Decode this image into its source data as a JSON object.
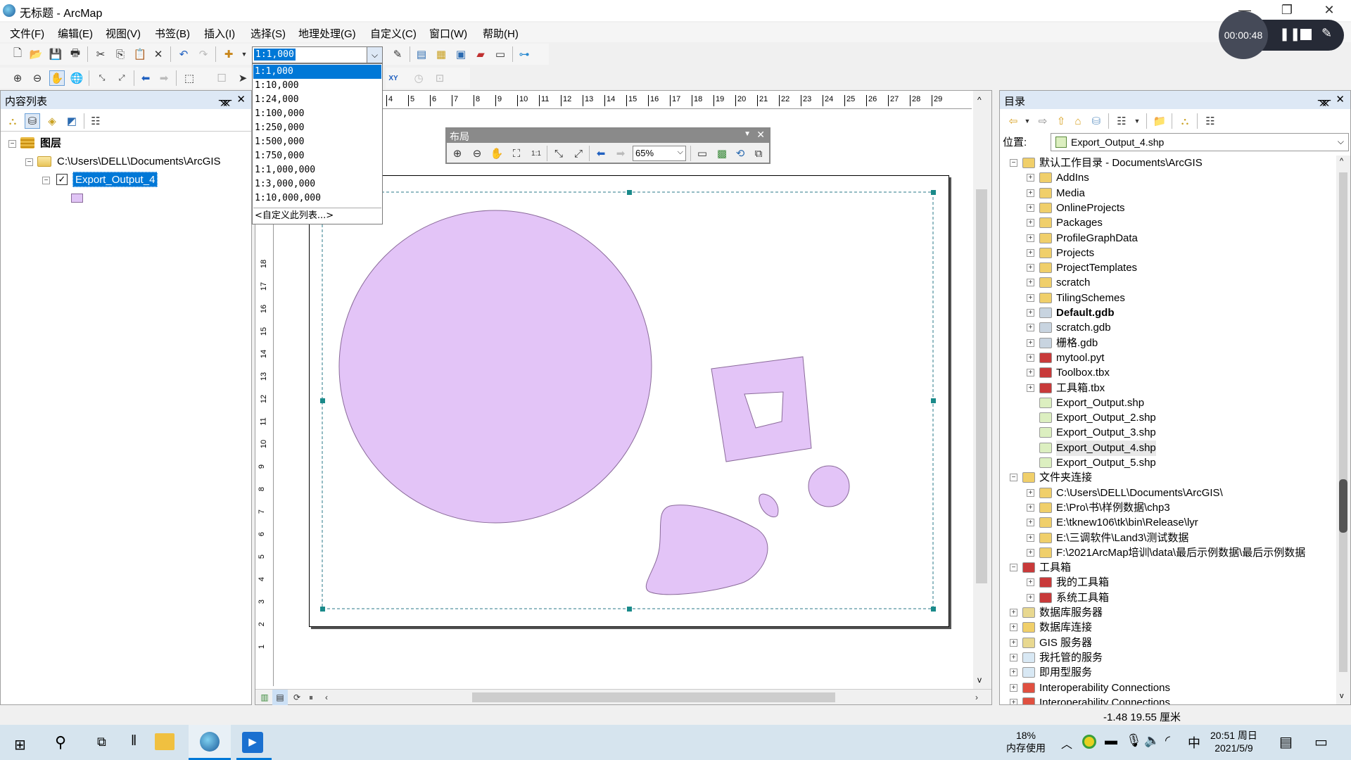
{
  "window": {
    "title": "无标题 - ArcMap",
    "controls": {
      "minimize": "—",
      "maximize": "❐",
      "close": "✕"
    }
  },
  "menu": [
    "文件(F)",
    "编辑(E)",
    "视图(V)",
    "书签(B)",
    "插入(I)",
    "选择(S)",
    "地理处理(G)",
    "自定义(C)",
    "窗口(W)",
    "帮助(H)"
  ],
  "scale": {
    "current": "1:1,000",
    "options": [
      "1:1,000",
      "1:10,000",
      "1:24,000",
      "1:100,000",
      "1:250,000",
      "1:500,000",
      "1:750,000",
      "1:1,000,000",
      "1:3,000,000",
      "1:10,000,000"
    ],
    "customize": "<自定义此列表...>"
  },
  "toc": {
    "title": "内容列表",
    "root": "图层",
    "folder": "C:\\Users\\DELL\\Documents\\ArcGIS",
    "layer": "Export_Output_4",
    "layer_checked": true,
    "symbol_color": "#e0c4f5"
  },
  "layout_toolbar": {
    "title": "布局",
    "zoom": "65%"
  },
  "ruler": {
    "h_ticks": [
      "4",
      "5",
      "6",
      "7",
      "8",
      "9",
      "10",
      "11",
      "12",
      "13",
      "14",
      "15",
      "16",
      "17",
      "18",
      "19",
      "20",
      "21",
      "22",
      "23",
      "24",
      "25",
      "26",
      "27",
      "28",
      "29"
    ],
    "v_ticks": [
      "18",
      "17",
      "16",
      "15",
      "14",
      "13",
      "12",
      "11",
      "10",
      "9",
      "8",
      "7",
      "6",
      "5",
      "4",
      "3",
      "2",
      "1"
    ]
  },
  "map": {
    "fill": "#e3c4f7",
    "stroke": "#8a6a9a"
  },
  "catalog": {
    "title": "目录",
    "location_label": "位置:",
    "location_value": "Export_Output_4.shp",
    "items": [
      {
        "label": "默认工作目录 - Documents\\ArcGIS",
        "level": 0,
        "exp": "−",
        "icon": "home-folder"
      },
      {
        "label": "AddIns",
        "level": 1,
        "exp": "+",
        "icon": "folder"
      },
      {
        "label": "Media",
        "level": 1,
        "exp": "+",
        "icon": "folder"
      },
      {
        "label": "OnlineProjects",
        "level": 1,
        "exp": "+",
        "icon": "folder"
      },
      {
        "label": "Packages",
        "level": 1,
        "exp": "+",
        "icon": "folder"
      },
      {
        "label": "ProfileGraphData",
        "level": 1,
        "exp": "+",
        "icon": "folder"
      },
      {
        "label": "Projects",
        "level": 1,
        "exp": "+",
        "icon": "folder"
      },
      {
        "label": "ProjectTemplates",
        "level": 1,
        "exp": "+",
        "icon": "folder"
      },
      {
        "label": "scratch",
        "level": 1,
        "exp": "+",
        "icon": "folder"
      },
      {
        "label": "TilingSchemes",
        "level": 1,
        "exp": "+",
        "icon": "folder"
      },
      {
        "label": "Default.gdb",
        "level": 1,
        "exp": "+",
        "icon": "gdb",
        "bold": true
      },
      {
        "label": "scratch.gdb",
        "level": 1,
        "exp": "+",
        "icon": "gdb"
      },
      {
        "label": "栅格.gdb",
        "level": 1,
        "exp": "+",
        "icon": "gdb"
      },
      {
        "label": "mytool.pyt",
        "level": 1,
        "exp": "+",
        "icon": "toolbox"
      },
      {
        "label": "Toolbox.tbx",
        "level": 1,
        "exp": "+",
        "icon": "toolbox"
      },
      {
        "label": "工具箱.tbx",
        "level": 1,
        "exp": "+",
        "icon": "toolbox"
      },
      {
        "label": "Export_Output.shp",
        "level": 1,
        "exp": "",
        "icon": "shp"
      },
      {
        "label": "Export_Output_2.shp",
        "level": 1,
        "exp": "",
        "icon": "shp"
      },
      {
        "label": "Export_Output_3.shp",
        "level": 1,
        "exp": "",
        "icon": "shp"
      },
      {
        "label": "Export_Output_4.shp",
        "level": 1,
        "exp": "",
        "icon": "shp",
        "selected": true
      },
      {
        "label": "Export_Output_5.shp",
        "level": 1,
        "exp": "",
        "icon": "shp"
      },
      {
        "label": "文件夹连接",
        "level": 0,
        "exp": "−",
        "icon": "folder"
      },
      {
        "label": "C:\\Users\\DELL\\Documents\\ArcGIS\\",
        "level": 1,
        "exp": "+",
        "icon": "folder"
      },
      {
        "label": "E:\\Pro\\书\\样例数据\\chp3",
        "level": 1,
        "exp": "+",
        "icon": "folder"
      },
      {
        "label": "E:\\tknew106\\tk\\bin\\Release\\lyr",
        "level": 1,
        "exp": "+",
        "icon": "folder"
      },
      {
        "label": "E:\\三调软件\\Land3\\测试数据",
        "level": 1,
        "exp": "+",
        "icon": "folder"
      },
      {
        "label": "F:\\2021ArcMap培训\\data\\最后示例数据\\最后示例数据",
        "level": 1,
        "exp": "+",
        "icon": "folder"
      },
      {
        "label": "工具箱",
        "level": 0,
        "exp": "−",
        "icon": "toolbox"
      },
      {
        "label": "我的工具箱",
        "level": 1,
        "exp": "+",
        "icon": "toolbox"
      },
      {
        "label": "系统工具箱",
        "level": 1,
        "exp": "+",
        "icon": "toolbox"
      },
      {
        "label": "数据库服务器",
        "level": 0,
        "exp": "+",
        "icon": "server"
      },
      {
        "label": "数据库连接",
        "level": 0,
        "exp": "+",
        "icon": "folder"
      },
      {
        "label": "GIS 服务器",
        "level": 0,
        "exp": "+",
        "icon": "server"
      },
      {
        "label": "我托管的服务",
        "level": 0,
        "exp": "+",
        "icon": "cloud"
      },
      {
        "label": "即用型服务",
        "level": 0,
        "exp": "+",
        "icon": "cloud"
      },
      {
        "label": "Interoperability Connections",
        "level": 0,
        "exp": "+",
        "icon": "interop"
      },
      {
        "label": "Interoperability Connections",
        "level": 0,
        "exp": "+",
        "icon": "interop"
      }
    ]
  },
  "status": {
    "coords": "-1.48  19.55 厘米"
  },
  "recorder": {
    "time": "00:00:48"
  },
  "taskbar": {
    "memory_pct": "18%",
    "memory_label": "内存使用",
    "ime": "中",
    "time": "20:51 周日",
    "date": "2021/5/9"
  }
}
